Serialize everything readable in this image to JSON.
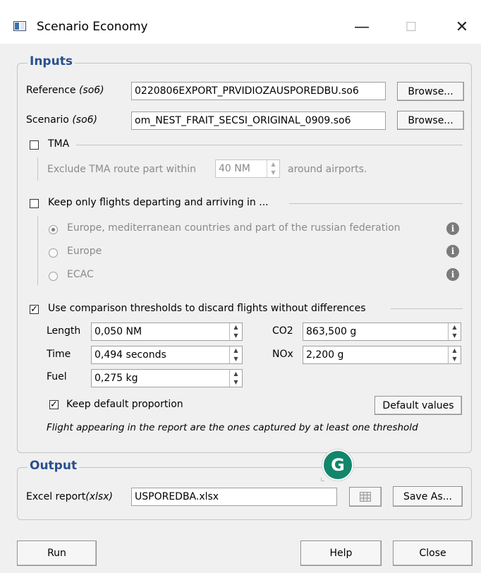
{
  "window": {
    "title": "Scenario Economy",
    "controls": {
      "minimize": "—",
      "maximize": "☐",
      "close": "✕"
    }
  },
  "inputs": {
    "legend": "Inputs",
    "reference": {
      "label": "Reference",
      "label_suffix": "(so6)",
      "value": "0220806EXPORT_PRVIDIOZAUSPOREDBU.so6",
      "browse_label": "Browse..."
    },
    "scenario": {
      "label": "Scenario",
      "label_suffix": "(so6)",
      "value": "om_NEST_FRAIT_SECSI_ORIGINAL_0909.so6",
      "browse_label": "Browse..."
    },
    "tma": {
      "checkbox_label": "TMA",
      "checked": false,
      "exclude_text_before": "Exclude TMA route part within",
      "value": "40 NM",
      "exclude_text_after": "around airports."
    },
    "keep_flights": {
      "checkbox_label": "Keep only flights departing and arriving in ...",
      "checked": false,
      "options": [
        {
          "label": "Europe, mediterranean countries and part of the russian federation",
          "selected": true
        },
        {
          "label": "Europe",
          "selected": false
        },
        {
          "label": "ECAC",
          "selected": false
        }
      ]
    },
    "thresholds": {
      "checkbox_label": "Use comparison thresholds to discard flights without differences",
      "checked": true,
      "length": {
        "label": "Length",
        "value": "0,050 NM"
      },
      "time": {
        "label": "Time",
        "value": "0,494 seconds"
      },
      "fuel": {
        "label": "Fuel",
        "value": "0,275 kg"
      },
      "co2": {
        "label": "CO2",
        "value": "863,500 g"
      },
      "nox": {
        "label": "NOx",
        "value": "2,200 g"
      },
      "keep_default_label": "Keep default proportion",
      "keep_default_checked": true,
      "default_values_label": "Default values",
      "note": "Flight appearing in the report are the ones captured by at least one threshold"
    }
  },
  "output": {
    "legend": "Output",
    "excel_label": "Excel report",
    "excel_suffix": "(xlsx)",
    "excel_value": "USPOREDBA.xlsx",
    "save_as_label": "Save As..."
  },
  "footer": {
    "run_label": "Run",
    "help_label": "Help",
    "close_label": "Close"
  },
  "overlay": {
    "grammarly_letter": "G"
  },
  "icons": {
    "info": "info-icon",
    "excel": "excel-icon",
    "app": "app-icon"
  },
  "colors": {
    "legend_text": "#2a4f8f",
    "dialog_bg": "#f0f0f0",
    "grammarly": "#12866a"
  }
}
